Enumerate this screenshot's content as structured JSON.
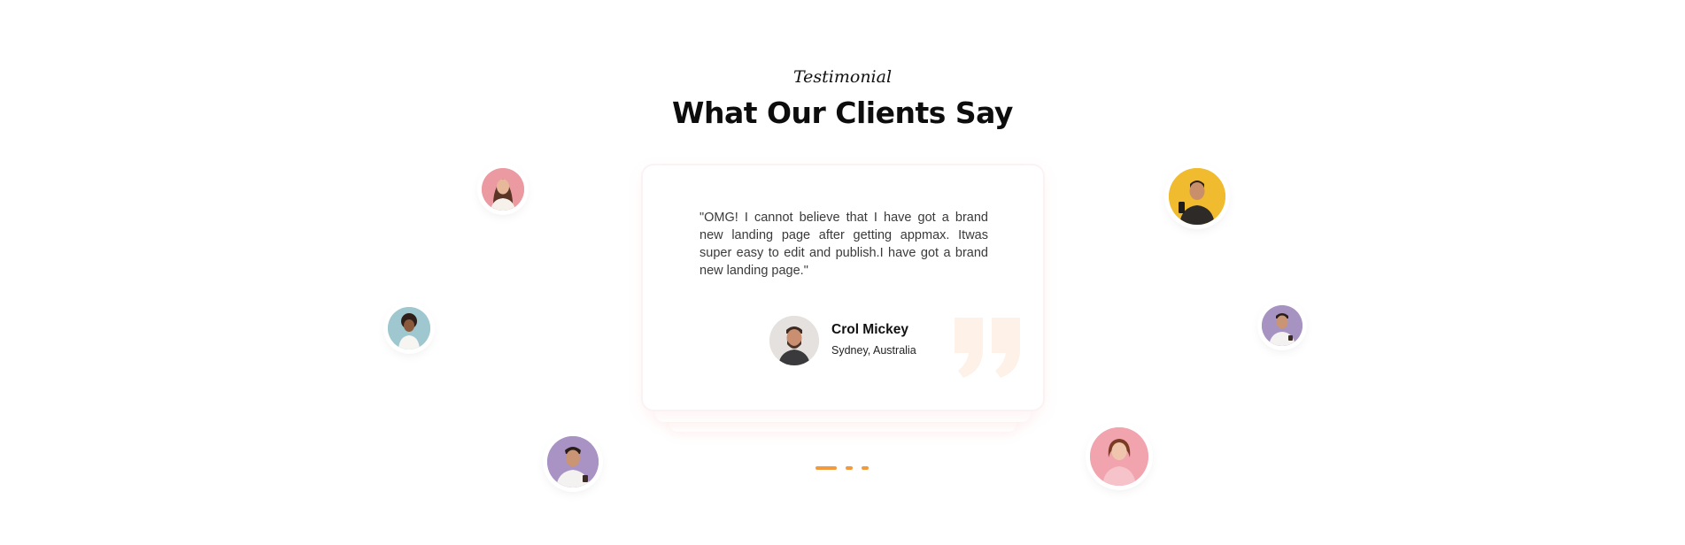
{
  "section": {
    "eyebrow": "Testimonial",
    "title": "What Our Clients Say"
  },
  "testimonial": {
    "quote": "\"OMG! I cannot believe that I have got a brand new landing page after getting appmax. Itwas super easy to edit and publish.I have got a brand new landing page.\"",
    "author_name": "Crol Mickey",
    "author_location": "Sydney, Australia"
  },
  "colors": {
    "accent": "#f39a3c",
    "quote_mark": "#fdf1e8"
  },
  "carousel": {
    "slide_count": 3,
    "active_index": 0
  },
  "icons": {
    "quote": "quote-mark-icon"
  }
}
